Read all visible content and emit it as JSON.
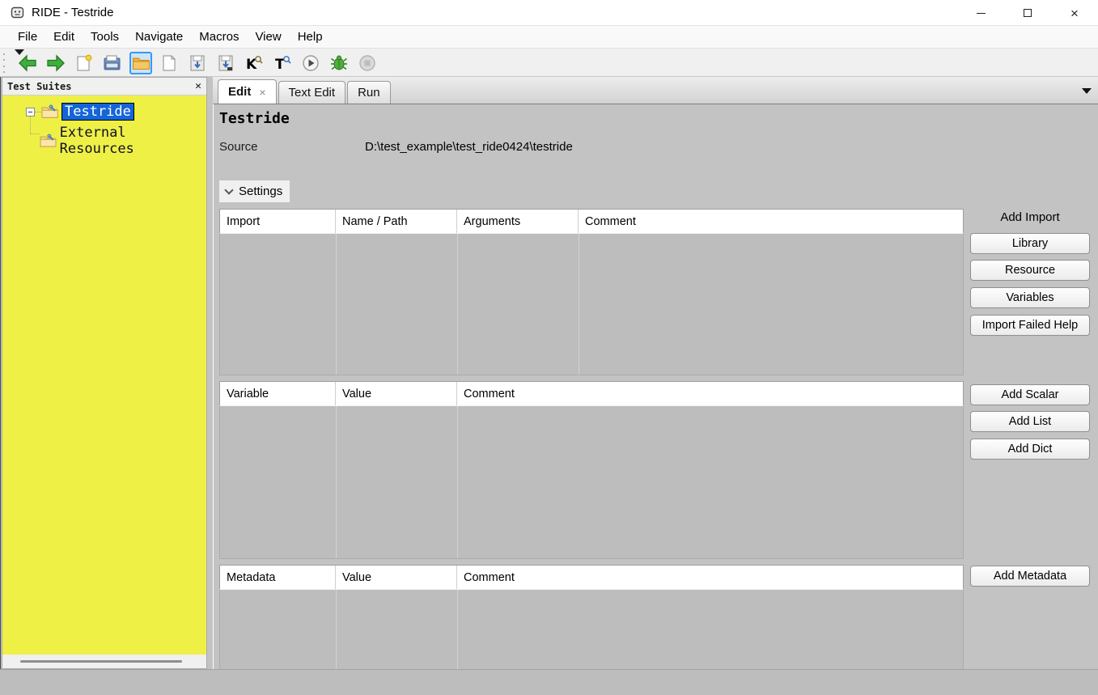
{
  "window": {
    "title": "RIDE - Testride",
    "controls": {
      "close": "×"
    }
  },
  "menu": {
    "items": [
      "File",
      "Edit",
      "Tools",
      "Navigate",
      "Macros",
      "View",
      "Help"
    ]
  },
  "toolbar": {
    "icons": [
      "go-back",
      "go-forward",
      "new-project",
      "open-file",
      "open-directory",
      "new-file",
      "save",
      "save-all",
      "search-keywords",
      "search-tests",
      "run-tests",
      "debug",
      "stop"
    ]
  },
  "sidebar": {
    "title": "Test Suites",
    "close_glyph": "✕",
    "tree": [
      {
        "label": "Testride",
        "selected": true
      },
      {
        "label": "External Resources",
        "selected": false
      }
    ]
  },
  "tabs": [
    {
      "label": "Edit",
      "active": true,
      "close_glyph": "×"
    },
    {
      "label": "Text Edit",
      "active": false
    },
    {
      "label": "Run",
      "active": false
    }
  ],
  "editor": {
    "heading": "Testride",
    "source_label": "Source",
    "source_value": "D:\\test_example\\test_ride0424\\testride",
    "settings_label": "Settings",
    "import_table": {
      "headers": [
        "Import",
        "Name / Path",
        "Arguments",
        "Comment"
      ],
      "rows": []
    },
    "variable_table": {
      "headers": [
        "Variable",
        "Value",
        "Comment"
      ],
      "rows": []
    },
    "metadata_table": {
      "headers": [
        "Metadata",
        "Value",
        "Comment"
      ],
      "rows": []
    },
    "import_actions": {
      "label": "Add Import",
      "buttons": [
        "Library",
        "Resource",
        "Variables",
        "Import Failed Help"
      ]
    },
    "variable_actions": {
      "buttons": [
        "Add Scalar",
        "Add List",
        "Add Dict"
      ]
    },
    "metadata_actions": {
      "buttons": [
        "Add Metadata"
      ]
    }
  },
  "colors": {
    "tree_background": "#eef046",
    "selection_blue": "#1565d8",
    "toggle_highlight": "#3399ff",
    "content_gray": "#c3c3c3",
    "grid_body_gray": "#bdbdbd",
    "arrow_green": "#3fae3f"
  }
}
